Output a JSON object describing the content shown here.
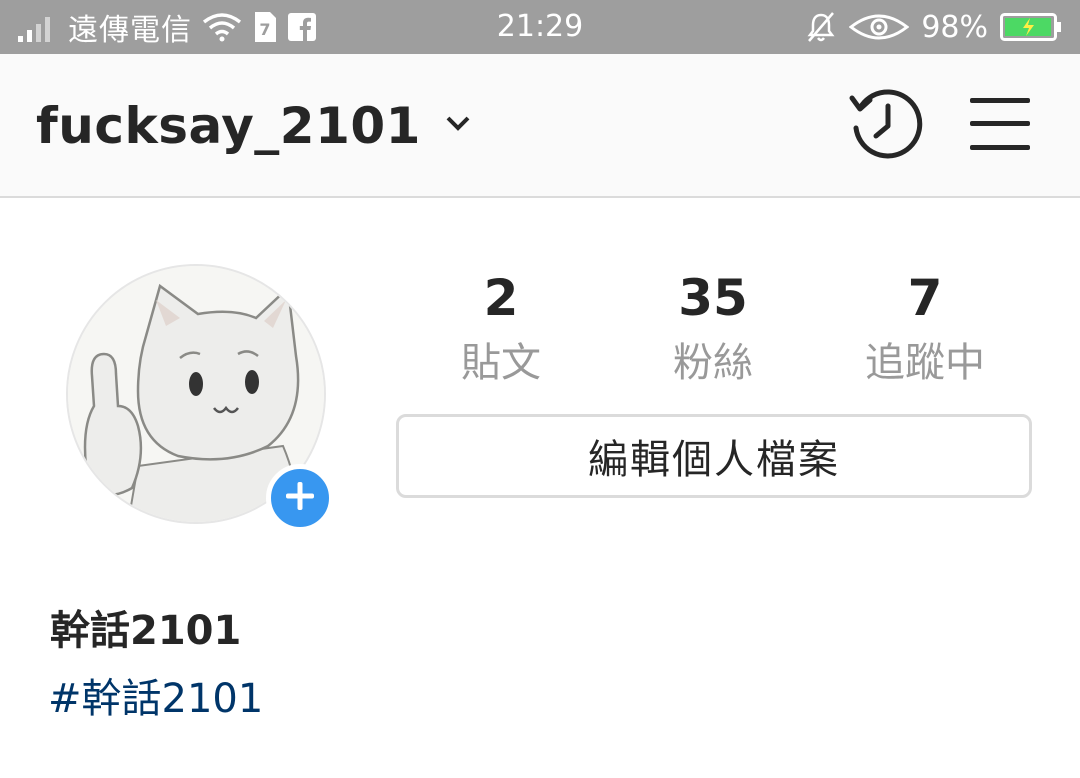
{
  "status_bar": {
    "carrier": "遠傳電信",
    "time": "21:29",
    "battery_percent": "98%",
    "battery_level": 0.98,
    "battery_color": "#4cd964",
    "icons": [
      "signal-icon",
      "wifi-icon",
      "sim-card-icon",
      "facebook-icon",
      "mute-bell-icon",
      "eye-icon",
      "battery-icon"
    ]
  },
  "header": {
    "username": "fucksay_2101",
    "icons": [
      "chevron-down-icon",
      "history-icon",
      "menu-icon"
    ]
  },
  "profile": {
    "stats": [
      {
        "count": "2",
        "label": "貼文"
      },
      {
        "count": "35",
        "label": "粉絲"
      },
      {
        "count": "7",
        "label": "追蹤中"
      }
    ],
    "edit_button_label": "編輯個人檔案",
    "full_name": "幹話2101",
    "bio_hashtag": "#幹話2101",
    "colors": {
      "accent_blue": "#3897f0",
      "hashtag": "#003569",
      "label_gray": "#999999"
    }
  }
}
